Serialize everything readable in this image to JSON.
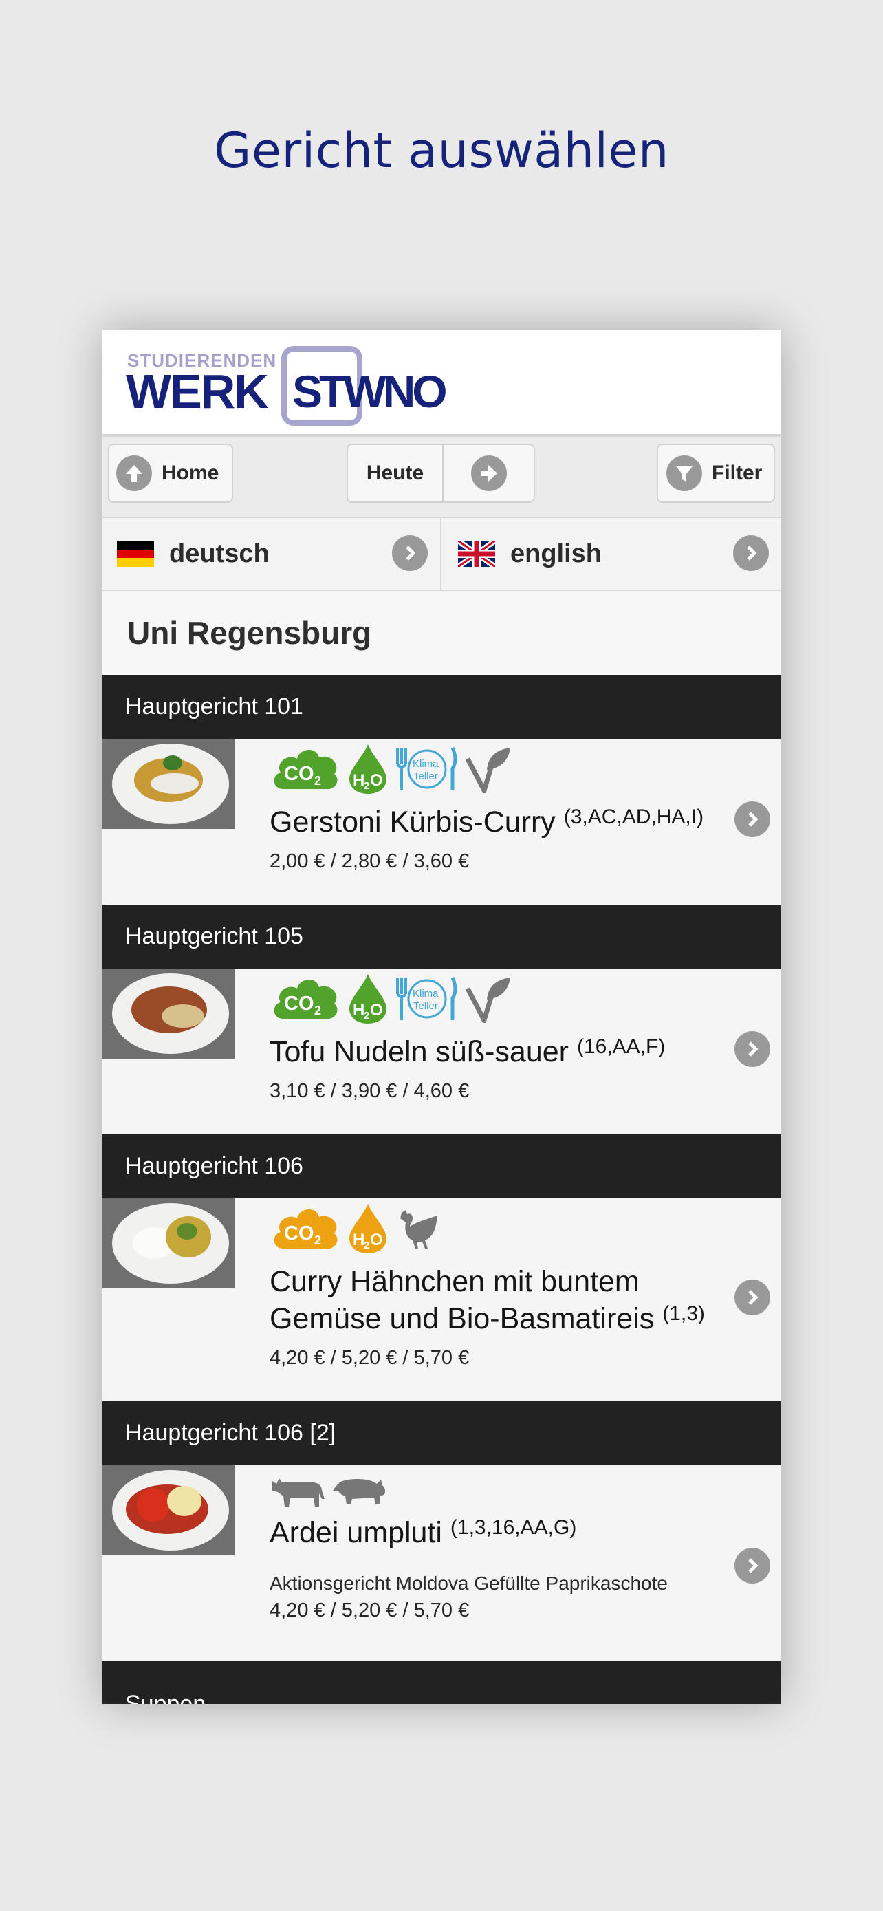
{
  "headline": "Gericht auswählen",
  "logo": {
    "small": "STUDIERENDEN",
    "werk": "WERK",
    "stwno": "STWNO"
  },
  "nav": {
    "home": "Home",
    "today": "Heute",
    "filter": "Filter"
  },
  "languages": {
    "german": "deutsch",
    "english": "english"
  },
  "location": "Uni Regensburg",
  "colors": {
    "green_badge": "#51a32c",
    "orange_badge": "#eca211",
    "klima_blue": "#43a6d6",
    "category_bar": "#222222",
    "headline": "#15237a"
  },
  "categories": [
    {
      "title": "Hauptgericht 101",
      "dish": {
        "name": "Gerstoni Kürbis-Curry",
        "allergens": "(3,AC,AD,HA,I)",
        "note": "",
        "price": "2,00 € / 2,80 € / 3,60 €",
        "badges": [
          "co2-green",
          "h2o-green",
          "klima-teller",
          "vegan"
        ]
      }
    },
    {
      "title": "Hauptgericht 105",
      "dish": {
        "name": "Tofu Nudeln süß-sauer",
        "allergens": "(16,AA,F)",
        "note": "",
        "price": "3,10 € / 3,90 € / 4,60 €",
        "badges": [
          "co2-green",
          "h2o-green",
          "klima-teller",
          "vegan"
        ]
      }
    },
    {
      "title": "Hauptgericht 106",
      "dish": {
        "name_line1": "Curry Hähnchen mit buntem",
        "name_line2": "Gemüse und Bio-Basmatireis",
        "allergens": "(1,3)",
        "note": "",
        "price": "4,20 € / 5,20 € / 5,70 €",
        "badges": [
          "co2-orange",
          "h2o-orange",
          "chicken"
        ]
      }
    },
    {
      "title": "Hauptgericht 106 [2]",
      "dish": {
        "name": "Ardei umpluti",
        "allergens": "(1,3,16,AA,G)",
        "note": "Aktionsgericht Moldova Gefüllte Paprikaschote",
        "price": "4,20 € / 5,20 € / 5,70 €",
        "badges": [
          "cow",
          "pig"
        ]
      }
    },
    {
      "title": "Suppen"
    }
  ],
  "badge_text": {
    "co2": "CO",
    "co2_sub": "2",
    "h2o_h": "H",
    "h2o_sub": "2",
    "h2o_o": "O",
    "klima1": "Klima",
    "klima2": "Teller"
  }
}
